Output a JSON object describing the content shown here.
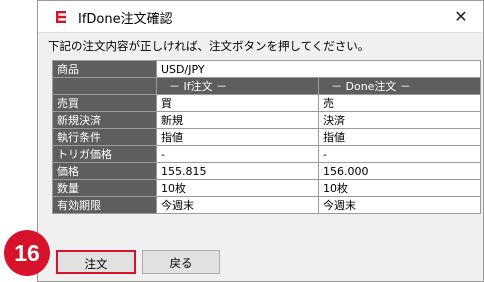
{
  "dialog": {
    "title": "IfDone注文確認",
    "close_glyph": "✕",
    "notice": "下記の注文内容が正しければ、注文ボタンを押してください。"
  },
  "table": {
    "symbol_label": "商品",
    "symbol_value": "USD/JPY",
    "if_header": "－  If注文  －",
    "done_header": "－  Done注文  －",
    "rows": [
      {
        "label": "売買",
        "if": "買",
        "done": "売"
      },
      {
        "label": "新規決済",
        "if": "新規",
        "done": "決済"
      },
      {
        "label": "執行条件",
        "if": "指値",
        "done": "指値"
      },
      {
        "label": "トリガ価格",
        "if": "-",
        "done": "-"
      },
      {
        "label": "価格",
        "if": "155.815",
        "done": "156.000"
      },
      {
        "label": "数量",
        "if": "10枚",
        "done": "10枚"
      },
      {
        "label": "有効期限",
        "if": "今週末",
        "done": "今週末"
      }
    ]
  },
  "buttons": {
    "order": "注文",
    "back": "戻る"
  },
  "step_badge": "16",
  "colors": {
    "buy": "#e02020",
    "sell": "#1a3fcc",
    "badge": "#d6132a",
    "header": "#5e5e5e"
  },
  "icons": {
    "app": "ifdone-app-icon",
    "close": "close-icon"
  }
}
